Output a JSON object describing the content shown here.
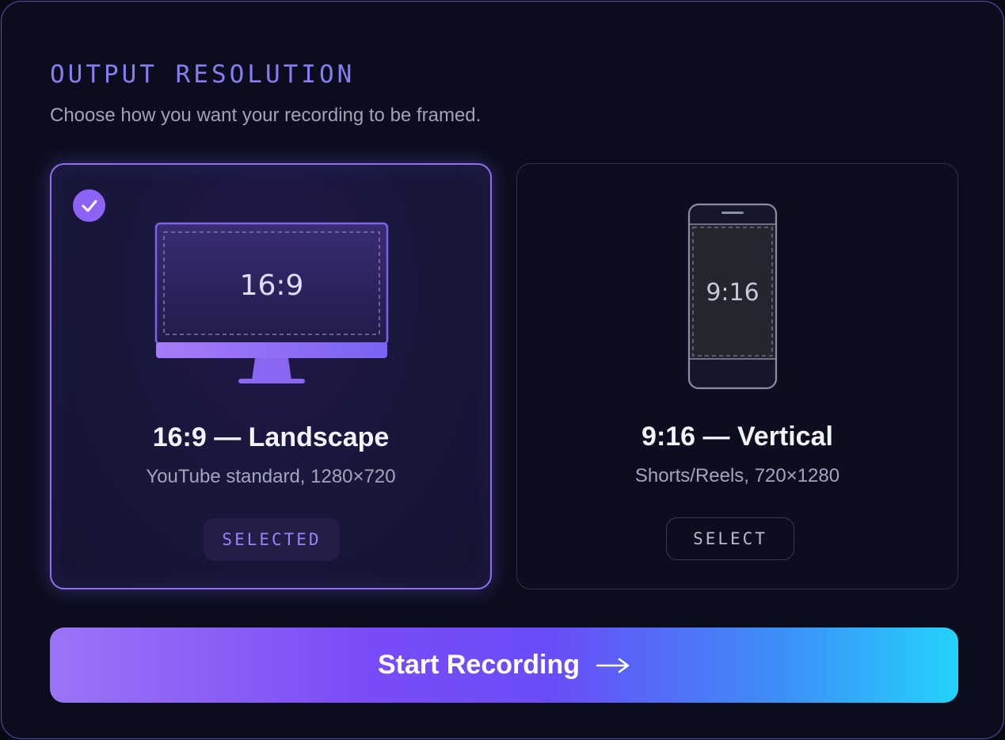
{
  "header": {
    "title": "OUTPUT RESOLUTION",
    "subtitle": "Choose how you want your recording to be framed."
  },
  "options": [
    {
      "ratio": "16:9",
      "title": "16:9 — Landscape",
      "description": "YouTube standard, 1280×720",
      "button_label": "SELECTED",
      "selected": true,
      "icon": "monitor-icon"
    },
    {
      "ratio": "9:16",
      "title": "9:16 — Vertical",
      "description": "Shorts/Reels, 720×1280",
      "button_label": "SELECT",
      "selected": false,
      "icon": "phone-icon"
    }
  ],
  "action": {
    "label": "Start Recording",
    "icon": "arrow-right-icon"
  },
  "colors": {
    "accent": "#8c63f4",
    "gradient_start": "#9a74f7",
    "gradient_end": "#24d2fb",
    "background": "#0b0d1e"
  }
}
